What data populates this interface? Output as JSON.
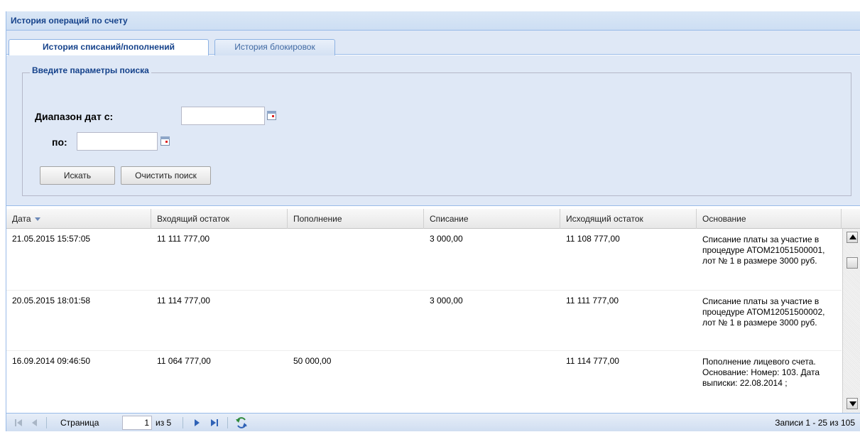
{
  "panel": {
    "title": "История операций по счету"
  },
  "tabs": [
    {
      "label": "История списаний/пополнений",
      "active": true
    },
    {
      "label": "История блокировок",
      "active": false
    }
  ],
  "search": {
    "legend": "Введите параметры поиска",
    "date_from_label": "Диапазон дат с:",
    "date_from_value": "",
    "date_to_label": "по:",
    "date_to_value": "",
    "search_button": "Искать",
    "clear_button": "Очистить поиск"
  },
  "grid": {
    "columns": [
      "Дата",
      "Входящий остаток",
      "Пополнение",
      "Списание",
      "Исходящий остаток",
      "Основание"
    ],
    "sort_column": "Дата",
    "rows": [
      {
        "date": "21.05.2015 15:57:05",
        "incoming": "11 111 777,00",
        "replenishment": "",
        "writeoff": "3 000,00",
        "outgoing": "11 108 777,00",
        "basis": "Списание платы за участие в процедуре АТОМ21051500001, лот № 1 в размере 3000 руб."
      },
      {
        "date": "20.05.2015 18:01:58",
        "incoming": "11 114 777,00",
        "replenishment": "",
        "writeoff": "3 000,00",
        "outgoing": "11 111 777,00",
        "basis": "Списание платы за участие в процедуре АТОМ12051500002, лот № 1 в размере 3000 руб."
      },
      {
        "date": "16.09.2014 09:46:50",
        "incoming": "11 064 777,00",
        "replenishment": "50 000,00",
        "writeoff": "",
        "outgoing": "11 114 777,00",
        "basis": "Пополнение лицевого счета. Основание: Номер: 103. Дата выписки: 22.08.2014 ;"
      }
    ]
  },
  "pager": {
    "page_label": "Страница",
    "current_page": "1",
    "of_label": "из 5",
    "records": "Записи 1 - 25 из 105"
  },
  "colors": {
    "header_text": "#15428b",
    "panel_border": "#99bbe8",
    "panel_bg": "#dfe8f6"
  }
}
